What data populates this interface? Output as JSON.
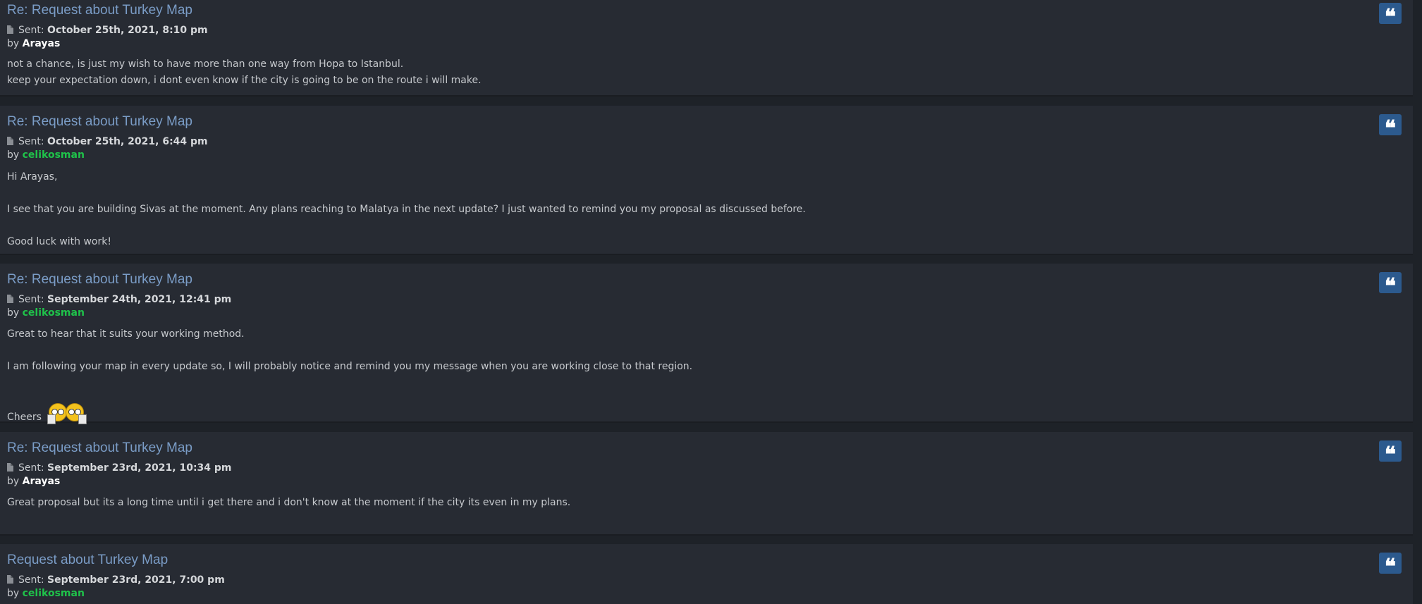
{
  "posts": [
    {
      "title": "Re: Request about Turkey Map",
      "sent_label": "Sent:",
      "date": "October 25th, 2021, 8:10 pm",
      "by": "by",
      "author": "Arayas",
      "lines": [
        "not a chance, is just my wish to have more than one way from Hopa to Istanbul.",
        "keep your expectation down, i dont even know if the city is going to be on the route i will make."
      ]
    },
    {
      "title": "Re: Request about Turkey Map",
      "sent_label": "Sent:",
      "date": "October 25th, 2021, 6:44 pm",
      "by": "by",
      "author": "celikosman",
      "lines": [
        "Hi Arayas,",
        "I see that you are building Sivas at the moment. Any plans reaching to Malatya in the next update? I just wanted to remind you my proposal as discussed before.",
        "Good luck with work!"
      ]
    },
    {
      "title": "Re: Request about Turkey Map",
      "sent_label": "Sent:",
      "date": "September 24th, 2021, 12:41 pm",
      "by": "by",
      "author": "celikosman",
      "lines": [
        "Great to hear that it suits your working method.",
        "I am following your map in every update so, I will probably notice and remind you my message when you are working close to that region.",
        "Cheers"
      ]
    },
    {
      "title": "Re: Request about Turkey Map",
      "sent_label": "Sent:",
      "date": "September 23rd, 2021, 10:34 pm",
      "by": "by",
      "author": "Arayas",
      "lines": [
        "Great proposal but its a long time until i get there and i don't know at the moment if the city its even in my plans."
      ]
    },
    {
      "title": "Request about Turkey Map",
      "sent_label": "Sent:",
      "date": "September 23rd, 2021, 7:00 pm",
      "by": "by",
      "author": "celikosman",
      "lines": []
    }
  ],
  "icons": {
    "file": "file-icon",
    "quote": "quote-icon",
    "smiley": "cheers-smiley-icon"
  },
  "colors": {
    "title": "#7a9cc6",
    "author_admin": "#ffffff",
    "author_member": "#1fc24a",
    "quote_button": "#2c5a8e"
  },
  "quote_glyph": "❝"
}
